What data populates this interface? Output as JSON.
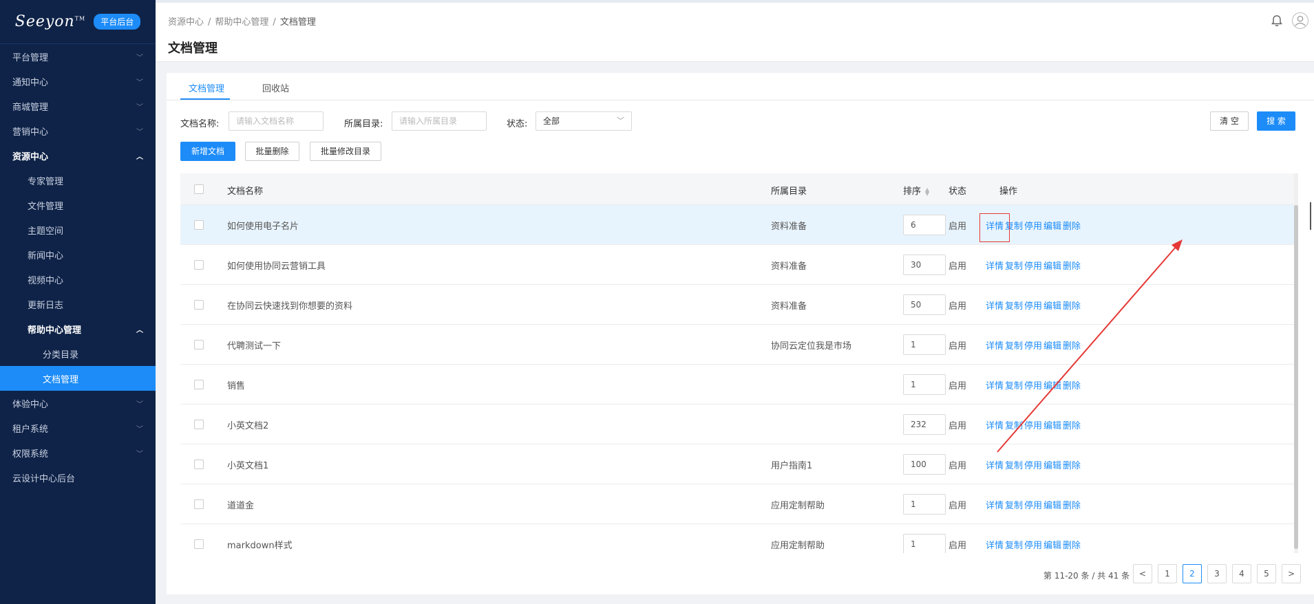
{
  "brand": {
    "logo": "Seeyon",
    "tm": "TM",
    "badge": "平台后台"
  },
  "sidebar": {
    "items": [
      {
        "label": "平台管理",
        "level": 0,
        "chevron": "down"
      },
      {
        "label": "通知中心",
        "level": 0,
        "chevron": "down"
      },
      {
        "label": "商城管理",
        "level": 0,
        "chevron": "down"
      },
      {
        "label": "营销中心",
        "level": 0,
        "chevron": "down"
      },
      {
        "label": "资源中心",
        "level": 0,
        "chevron": "up",
        "open": true
      },
      {
        "label": "专家管理",
        "level": 1
      },
      {
        "label": "文件管理",
        "level": 1
      },
      {
        "label": "主题空间",
        "level": 1
      },
      {
        "label": "新闻中心",
        "level": 1
      },
      {
        "label": "视频中心",
        "level": 1
      },
      {
        "label": "更新日志",
        "level": 1
      },
      {
        "label": "帮助中心管理",
        "level": 1,
        "chevron": "up",
        "open": true
      },
      {
        "label": "分类目录",
        "level": 2
      },
      {
        "label": "文档管理",
        "level": 2,
        "active": true
      },
      {
        "label": "体验中心",
        "level": 0,
        "chevron": "down"
      },
      {
        "label": "租户系统",
        "level": 0,
        "chevron": "down"
      },
      {
        "label": "权限系统",
        "level": 0,
        "chevron": "down"
      },
      {
        "label": "云设计中心后台",
        "level": 0
      }
    ]
  },
  "header": {
    "breadcrumb": [
      "资源中心",
      "帮助中心管理",
      "文档管理"
    ],
    "sep": "/",
    "title": "文档管理"
  },
  "tabs": [
    "文档管理",
    "回收站"
  ],
  "filters": {
    "name_label": "文档名称:",
    "name_placeholder": "请输入文档名称",
    "dir_label": "所属目录:",
    "dir_placeholder": "请输入所属目录",
    "status_label": "状态:",
    "status_value": "全部"
  },
  "buttons": {
    "clear": "清 空",
    "search": "搜 索",
    "add": "新增文档",
    "batch_delete": "批量删除",
    "batch_move": "批量修改目录"
  },
  "table": {
    "headers": {
      "name": "文档名称",
      "dir": "所属目录",
      "order": "排序",
      "status": "状态",
      "ops": "操作"
    },
    "actions": [
      "详情",
      "复制",
      "停用",
      "编辑",
      "删除"
    ],
    "rows": [
      {
        "name": "如何使用电子名片",
        "dir": "资料准备",
        "order": "6",
        "status": "启用"
      },
      {
        "name": "如何使用协同云营销工具",
        "dir": "资料准备",
        "order": "30",
        "status": "启用"
      },
      {
        "name": "在协同云快速找到你想要的资料",
        "dir": "资料准备",
        "order": "50",
        "status": "启用"
      },
      {
        "name": "代聘测试一下",
        "dir": "协同云定位我是市场",
        "order": "1",
        "status": "启用"
      },
      {
        "name": "销售",
        "dir": "",
        "order": "1",
        "status": "启用"
      },
      {
        "name": "小英文档2",
        "dir": "",
        "order": "232",
        "status": "启用"
      },
      {
        "name": "小英文档1",
        "dir": "用户指南1",
        "order": "100",
        "status": "启用"
      },
      {
        "name": "道道金",
        "dir": "应用定制帮助",
        "order": "1",
        "status": "启用"
      },
      {
        "name": "markdown样式",
        "dir": "应用定制帮助",
        "order": "1",
        "status": "启用"
      }
    ]
  },
  "pagination": {
    "total_text": "第 11-20 条 / 共 41 条",
    "prev": "<",
    "next": ">",
    "pages": [
      "1",
      "2",
      "3",
      "4",
      "5"
    ],
    "current": "2"
  },
  "colors": {
    "sidebar_bg": "#0f2348",
    "accent": "#1d8cf8",
    "annotation": "#e53935"
  }
}
